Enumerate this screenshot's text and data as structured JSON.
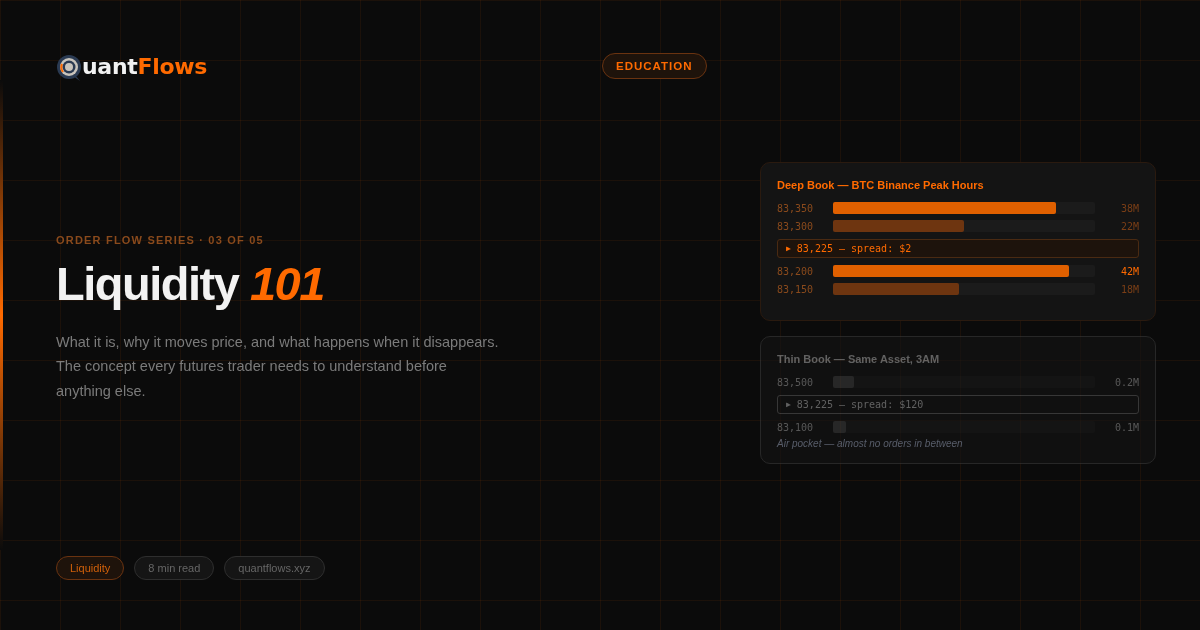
{
  "brand": {
    "lead": "uant",
    "accent": "Flows"
  },
  "category": "EDUCATION",
  "series_label": "ORDER FLOW SERIES · 03 OF 05",
  "title": {
    "text": "Liquidity",
    "accent": "101"
  },
  "description": "What it is, why it moves price, and what happens when it disappears. The concept every futures trader needs to understand before anything else.",
  "books": [
    {
      "title": "Deep Book — BTC Binance Peak Hours",
      "dimmed": false,
      "rows": [
        {
          "kind": "level",
          "price": "83,350",
          "level": 0.85,
          "bright": true,
          "value": "38M",
          "value_bright": false
        },
        {
          "kind": "level",
          "price": "83,300",
          "level": 0.5,
          "bright": false,
          "value": "22M",
          "value_bright": false
        },
        {
          "kind": "spread",
          "marker": "▶",
          "text": "83,225 — spread: $2"
        },
        {
          "kind": "level",
          "price": "83,200",
          "level": 0.9,
          "bright": true,
          "value": "42M",
          "value_bright": true
        },
        {
          "kind": "level",
          "price": "83,150",
          "level": 0.48,
          "bright": false,
          "value": "18M",
          "value_bright": false
        }
      ]
    },
    {
      "title": "Thin Book — Same Asset, 3AM",
      "dimmed": true,
      "note": "Air pocket — almost no orders in between",
      "rows": [
        {
          "kind": "level",
          "price": "83,500",
          "level": 0.08,
          "bright": false,
          "value": "0.2M",
          "value_bright": false
        },
        {
          "kind": "spread",
          "marker": "▶",
          "text": "83,225 — spread: $120"
        },
        {
          "kind": "level",
          "price": "83,100",
          "level": 0.05,
          "bright": false,
          "value": "0.1M",
          "value_bright": false
        }
      ]
    }
  ],
  "tags": [
    {
      "label": "Liquidity",
      "kind": "accent"
    },
    {
      "label": "8 min read",
      "kind": "plain"
    },
    {
      "label": "quantflows.xyz",
      "kind": "plain"
    }
  ]
}
